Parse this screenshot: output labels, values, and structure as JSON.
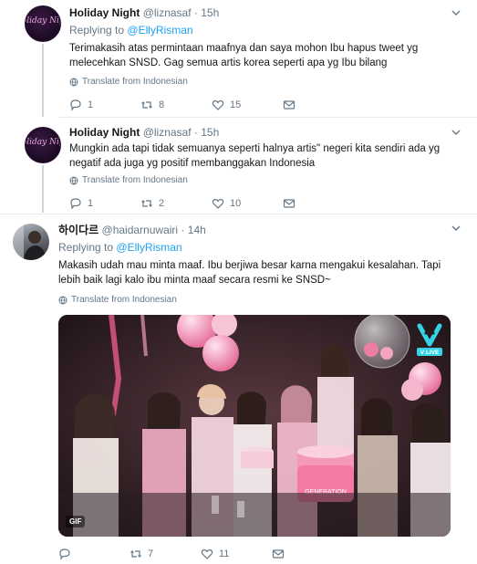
{
  "tweets": [
    {
      "name": "Holiday Night",
      "handle": "@liznasaf",
      "time": "15h",
      "reply_prefix": "Replying to",
      "reply_to": "@EllyRisman",
      "text": "Terimakasih atas permintaan maafnya dan saya mohon Ibu hapus tweet yg melecehkan SNSD. Gag semua artis korea seperti apa yg Ibu bilang",
      "translate": "Translate from Indonesian",
      "replies": "1",
      "retweets": "8",
      "likes": "15"
    },
    {
      "name": "Holiday Night",
      "handle": "@liznasaf",
      "time": "15h",
      "text": "Mungkin ada tapi tidak semuanya seperti halnya artis\" negeri kita sendiri ada yg negatif ada juga yg positif membanggakan Indonesia",
      "translate": "Translate from Indonesian",
      "replies": "1",
      "retweets": "2",
      "likes": "10"
    },
    {
      "name": "하이다르",
      "handle": "@haidarnuwairi",
      "time": "14h",
      "reply_prefix": "Replying to",
      "reply_to": "@EllyRisman",
      "text": "Makasih udah mau minta maaf. Ibu berjiwa besar karna mengakui kesalahan. Tapi lebih baik lagi kalo ibu minta maaf secara resmi ke SNSD~",
      "translate": "Translate from Indonesian",
      "media_badge": "GIF",
      "replies": "",
      "retweets": "7",
      "likes": "11"
    }
  ],
  "avatar_logo_text": "Holiday Night",
  "vlive_label": "V LIVE",
  "cake_text": "GENERATION",
  "colors": {
    "accent": "#1da1f2",
    "muted": "#657786",
    "divider": "#e6ecf0"
  }
}
